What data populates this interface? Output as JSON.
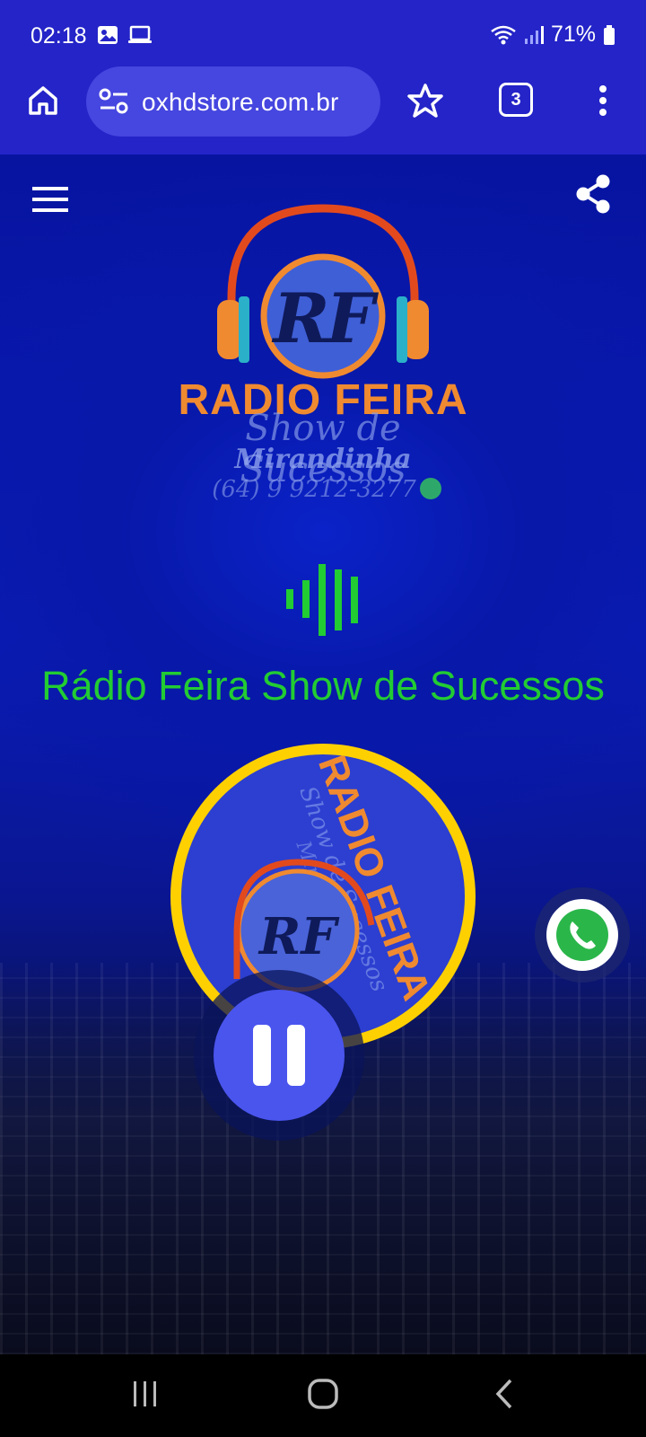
{
  "status_bar": {
    "time": "02:18",
    "battery": "71%"
  },
  "browser": {
    "url": "oxhdstore.com.br",
    "tab_count": "3"
  },
  "logo": {
    "monogram": "RF",
    "title": "RADIO FEIRA",
    "subtitle": "Show de Sucessos",
    "host": "Mirandinha",
    "phone": "(64) 9 9212-3277"
  },
  "player": {
    "station_name": "Rádio Feira Show de Sucessos",
    "state": "playing"
  },
  "colors": {
    "accent_green": "#22cc33",
    "browser_blue": "#2424c8",
    "play_button": "#4a55ee",
    "logo_orange": "#f08a30",
    "ring_yellow": "#ffd000"
  }
}
